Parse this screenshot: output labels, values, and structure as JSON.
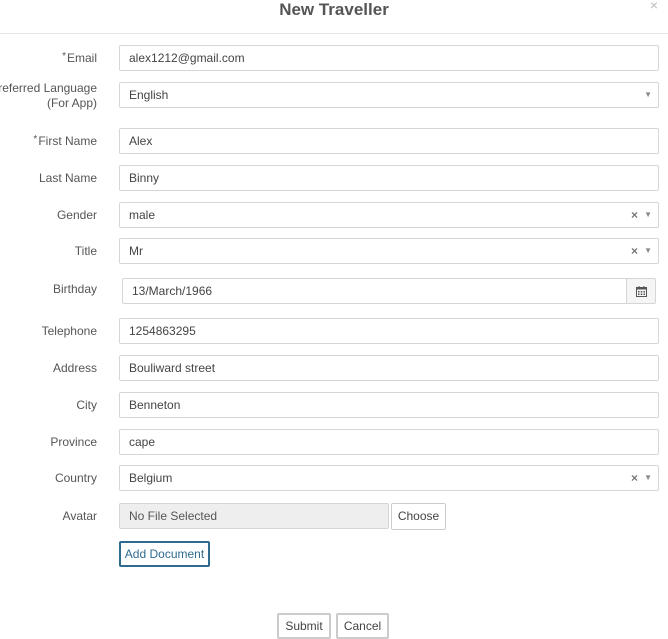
{
  "modal": {
    "title": "New Traveller",
    "close_glyph": "×"
  },
  "form": {
    "email": {
      "label": "Email",
      "required_mark": "*",
      "value": "alex1212@gmail.com"
    },
    "preferred_language": {
      "label": "Preferred Language (For App)",
      "value": "English"
    },
    "first_name": {
      "label": "First Name",
      "required_mark": "*",
      "value": "Alex"
    },
    "last_name": {
      "label": "Last Name",
      "value": "Binny"
    },
    "gender": {
      "label": "Gender",
      "value": "male"
    },
    "title": {
      "label": "Title",
      "value": "Mr"
    },
    "birthday": {
      "label": "Birthday",
      "value": "13/March/1966"
    },
    "telephone": {
      "label": "Telephone",
      "value": "1254863295"
    },
    "address": {
      "label": "Address",
      "value": "Bouliward street"
    },
    "city": {
      "label": "City",
      "value": "Benneton"
    },
    "province": {
      "label": "Province",
      "value": "cape"
    },
    "country": {
      "label": "Country",
      "value": "Belgium"
    },
    "avatar": {
      "label": "Avatar",
      "file_text": "No File Selected",
      "choose_label": "Choose"
    }
  },
  "buttons": {
    "add_document": "Add Document",
    "submit": "Submit",
    "cancel": "Cancel"
  },
  "glyphs": {
    "dropdown_arrow": "▼",
    "clear": "×"
  },
  "colors": {
    "accent": "#2e6b8f",
    "border": "#d6d6d6"
  }
}
